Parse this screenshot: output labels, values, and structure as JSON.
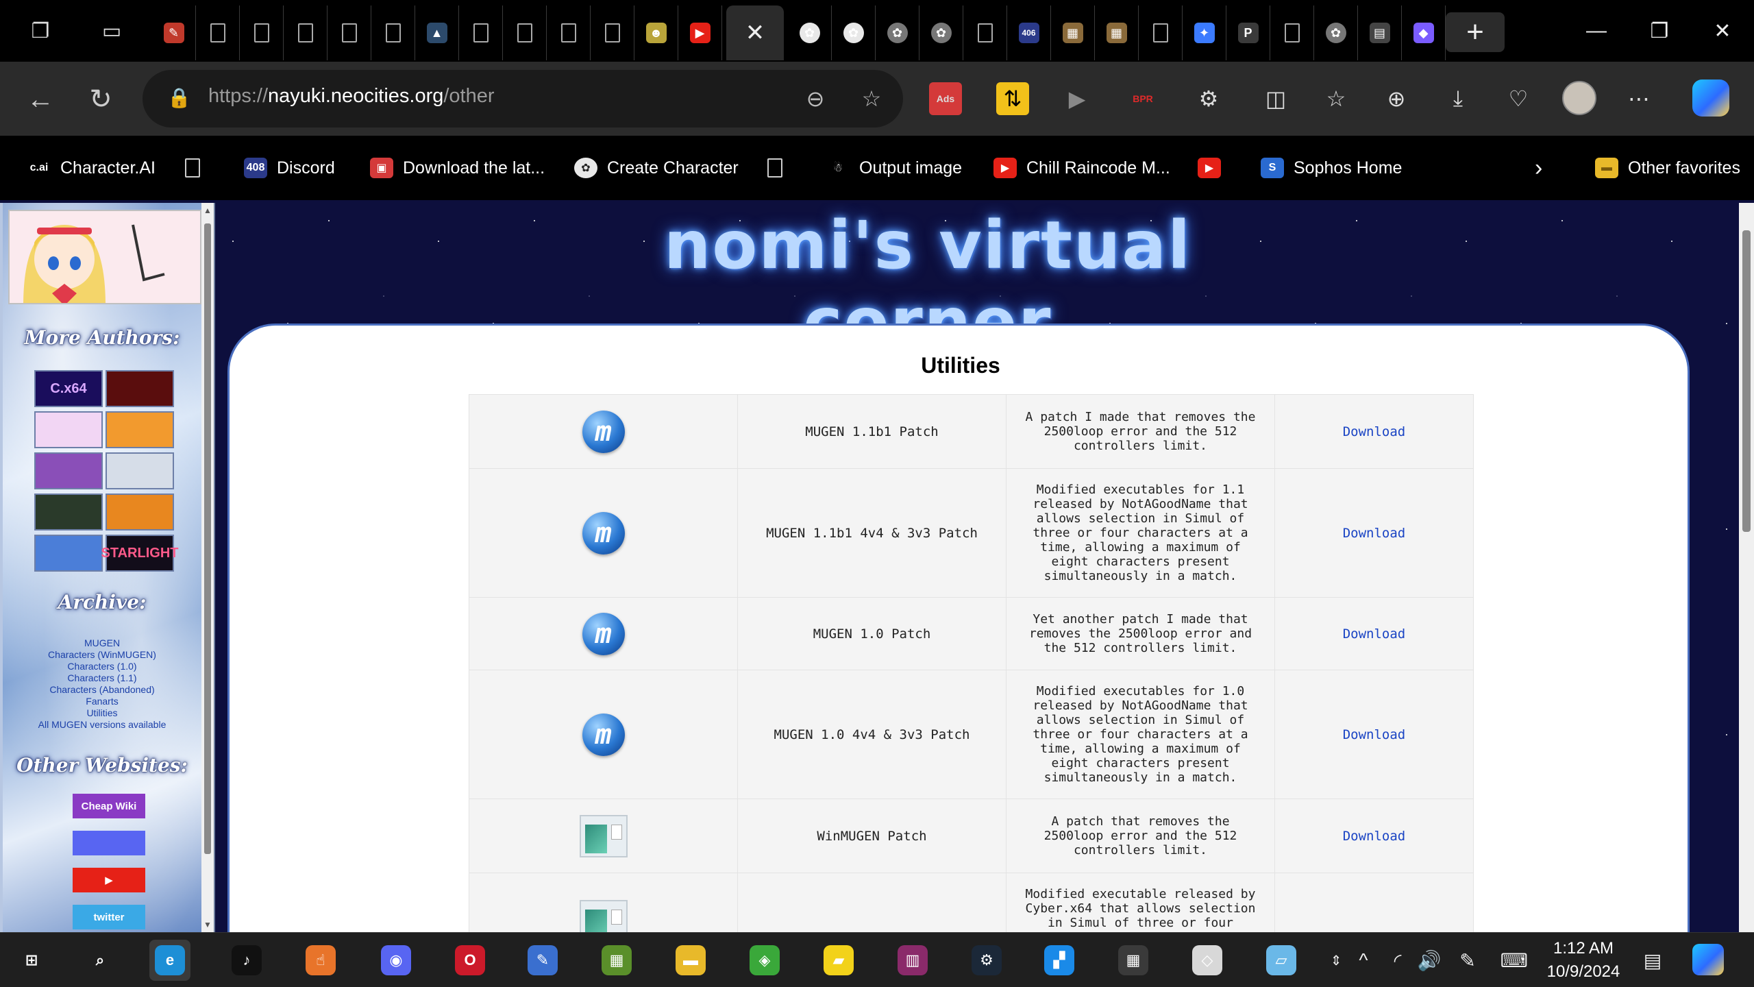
{
  "browser": {
    "tabs": [
      {
        "icon": "notepad-icon",
        "color": "#c0392b",
        "glyph": "✎"
      },
      {
        "icon": "doc-icon"
      },
      {
        "icon": "doc-icon"
      },
      {
        "icon": "doc-icon"
      },
      {
        "icon": "doc-icon"
      },
      {
        "icon": "doc-icon"
      },
      {
        "icon": "triangle-app-icon",
        "color": "#2c4a6b",
        "glyph": "▲"
      },
      {
        "icon": "doc-icon"
      },
      {
        "icon": "doc-icon"
      },
      {
        "icon": "doc-icon"
      },
      {
        "icon": "doc-icon"
      },
      {
        "icon": "chat-bubble-icon",
        "color": "#b9a43a",
        "glyph": "☻"
      },
      {
        "icon": "youtube-icon",
        "color": "#e62117",
        "glyph": "▶"
      },
      {
        "icon": "close-icon",
        "active": true,
        "glyph": "✕"
      },
      {
        "icon": "openai-icon",
        "color": "#e8e8e8",
        "glyph": "✿"
      },
      {
        "icon": "openai-icon",
        "color": "#e8e8e8",
        "glyph": "✿"
      },
      {
        "icon": "openai-icon",
        "color": "#777777",
        "glyph": "✿"
      },
      {
        "icon": "openai-icon",
        "color": "#777777",
        "glyph": "✿"
      },
      {
        "icon": "doc-icon"
      },
      {
        "icon": "discord-408-icon",
        "color": "#2b3a8a",
        "glyph": "406"
      },
      {
        "icon": "box-icon",
        "color": "#8a6a3a",
        "glyph": "▦"
      },
      {
        "icon": "box-icon",
        "color": "#8a6a3a",
        "glyph": "▦"
      },
      {
        "icon": "doc-icon"
      },
      {
        "icon": "sparkle-icon",
        "color": "#3b7bff",
        "glyph": "✦"
      },
      {
        "icon": "p-icon",
        "color": "#3a3a3a",
        "glyph": "P"
      },
      {
        "icon": "doc-icon"
      },
      {
        "icon": "openai-icon",
        "color": "#777777",
        "glyph": "✿"
      },
      {
        "icon": "window-icon",
        "color": "#444444",
        "glyph": "▤"
      },
      {
        "icon": "copilot-icon",
        "color": "#7a5cff",
        "glyph": "◆"
      }
    ],
    "new_tab_label": "+",
    "url_scheme": "https://",
    "url_host": "nayuki.neocities.org",
    "url_path": "/other"
  },
  "favorites": [
    {
      "label": "Character.AI",
      "icon": "character-ai-icon",
      "glyph": "c.ai"
    },
    {
      "label": "",
      "icon": "doc-icon"
    },
    {
      "label": "Discord",
      "icon": "discord-icon",
      "glyph": "408"
    },
    {
      "label": "Download the lat...",
      "icon": "download-app-icon",
      "glyph": "▣"
    },
    {
      "label": "Create Character",
      "icon": "openai-icon",
      "glyph": "✿"
    },
    {
      "label": "",
      "icon": "doc-icon"
    },
    {
      "label": "Output image",
      "icon": "ghost-icon",
      "glyph": "☃"
    },
    {
      "label": "Chill Raincode M...",
      "icon": "youtube-icon",
      "glyph": "▶"
    },
    {
      "label": "",
      "icon": "youtube-icon",
      "glyph": "▶"
    },
    {
      "label": "Sophos Home",
      "icon": "sophos-icon",
      "glyph": "S"
    }
  ],
  "favorites_more": "Other favorites",
  "sidebar": {
    "heading_authors": "More Authors:",
    "authors": [
      {
        "label": "C.x64",
        "bg": "#1a0d5c",
        "fg": "#d9a8ff"
      },
      {
        "label": "",
        "bg": "#5a0d0d",
        "fg": "#fff"
      },
      {
        "label": "",
        "bg": "#f2d6f4",
        "fg": "#fff"
      },
      {
        "label": "",
        "bg": "#f29a2e",
        "fg": "#fff"
      },
      {
        "label": "",
        "bg": "#8a4fb8",
        "fg": "#fff"
      },
      {
        "label": "",
        "bg": "#d6dde8",
        "fg": "#fff"
      },
      {
        "label": "",
        "bg": "#2a3a2a",
        "fg": "#fff"
      },
      {
        "label": "",
        "bg": "#e8871f",
        "fg": "#fff"
      },
      {
        "label": "",
        "bg": "#4b7ed8",
        "fg": "#fff"
      },
      {
        "label": "STARLIGHT",
        "bg": "#120d1a",
        "fg": "#ff5a8a"
      }
    ],
    "heading_archive": "Archive:",
    "archive_links": [
      "MUGEN",
      "Characters (WinMUGEN)",
      "Characters (1.0)",
      "Characters (1.1)",
      "Characters (Abandoned)",
      "Fanarts",
      "Utilities",
      "All MUGEN versions available"
    ],
    "heading_websites": "Other Websites:",
    "websites": [
      {
        "label": "Cheap Wiki",
        "icon": "cheap-wiki-icon",
        "bg": "#8a3ac4"
      },
      {
        "label": "",
        "icon": "discord-icon",
        "bg": "#5865f2"
      },
      {
        "label": "▶",
        "icon": "youtube-icon",
        "bg": "#e62117"
      },
      {
        "label": "twitter",
        "icon": "twitter-icon",
        "bg": "#3aa9e6"
      }
    ]
  },
  "site_title": "nomi's virtual corner",
  "page_heading": "Utilities",
  "utilities": [
    {
      "icon": "mugen-icon",
      "name": "MUGEN 1.1b1 Patch",
      "desc": "A patch I made that removes the 2500loop error and the 512 controllers limit.",
      "link": "Download"
    },
    {
      "icon": "mugen-icon",
      "name": "MUGEN 1.1b1 4v4 & 3v3 Patch",
      "desc": "Modified executables for 1.1 released by NotAGoodName that allows selection in Simul of three or four characters at a time, allowing a maximum of eight characters present simultaneously in a match.",
      "link": "Download"
    },
    {
      "icon": "mugen-icon",
      "name": "MUGEN 1.0 Patch",
      "desc": "Yet another patch I made that removes the 2500loop error and the 512 controllers limit.",
      "link": "Download"
    },
    {
      "icon": "mugen-icon",
      "name": "MUGEN 1.0 4v4 & 3v3 Patch",
      "desc": "Modified executables for 1.0 released by NotAGoodName that allows selection in Simul of three or four characters at a time, allowing a maximum of eight characters present simultaneously in a match.",
      "link": "Download"
    },
    {
      "icon": "winmugen-icon",
      "name": "WinMUGEN Patch",
      "desc": "A patch that removes the 2500loop error and the 512 controllers limit.",
      "link": "Download"
    },
    {
      "icon": "winmugen-icon",
      "name": "",
      "desc": "Modified executable released by Cyber.x64 that allows selection in Simul of three or four",
      "link": ""
    }
  ],
  "taskbar": {
    "apps": [
      {
        "icon": "windows-start-icon",
        "glyph": "⊞",
        "bg": "transparent"
      },
      {
        "icon": "search-icon",
        "glyph": "⌕",
        "bg": "transparent"
      },
      {
        "icon": "edge-icon",
        "glyph": "e",
        "bg": "#1d8fd6",
        "active": true
      },
      {
        "icon": "tiktok-icon",
        "glyph": "♪",
        "bg": "#111111"
      },
      {
        "icon": "touch-app-icon",
        "glyph": "☝",
        "bg": "#e8742a"
      },
      {
        "icon": "discord-icon",
        "glyph": "◉",
        "bg": "#5865f2"
      },
      {
        "icon": "opera-icon",
        "glyph": "O",
        "bg": "#cc1a2a"
      },
      {
        "icon": "paint-icon",
        "glyph": "✎",
        "bg": "#3a6fcf"
      },
      {
        "icon": "minecraft-icon",
        "glyph": "▦",
        "bg": "#5a8f2a"
      },
      {
        "icon": "file-explorer-icon",
        "glyph": "▬",
        "bg": "#e8b92a"
      },
      {
        "icon": "bluestacks-icon",
        "glyph": "◈",
        "bg": "#3aa83a"
      },
      {
        "icon": "sticky-notes-icon",
        "glyph": "▰",
        "bg": "#f2d21a"
      },
      {
        "icon": "winrar-icon",
        "glyph": "▥",
        "bg": "#8a2a6a"
      },
      {
        "icon": "steam-icon",
        "glyph": "⚙",
        "bg": "#1b2838"
      },
      {
        "icon": "blue-app-icon",
        "glyph": "▞",
        "bg": "#1a8ae8"
      },
      {
        "icon": "microsoft-store-icon",
        "glyph": "▦",
        "bg": "#3a3a3a"
      },
      {
        "icon": "roblox-icon",
        "glyph": "◇",
        "bg": "#d8d8d8"
      },
      {
        "icon": "notes-app-icon",
        "glyph": "▱",
        "bg": "#6ab8e8"
      }
    ],
    "time": "1:12 AM",
    "date": "10/9/2024"
  }
}
